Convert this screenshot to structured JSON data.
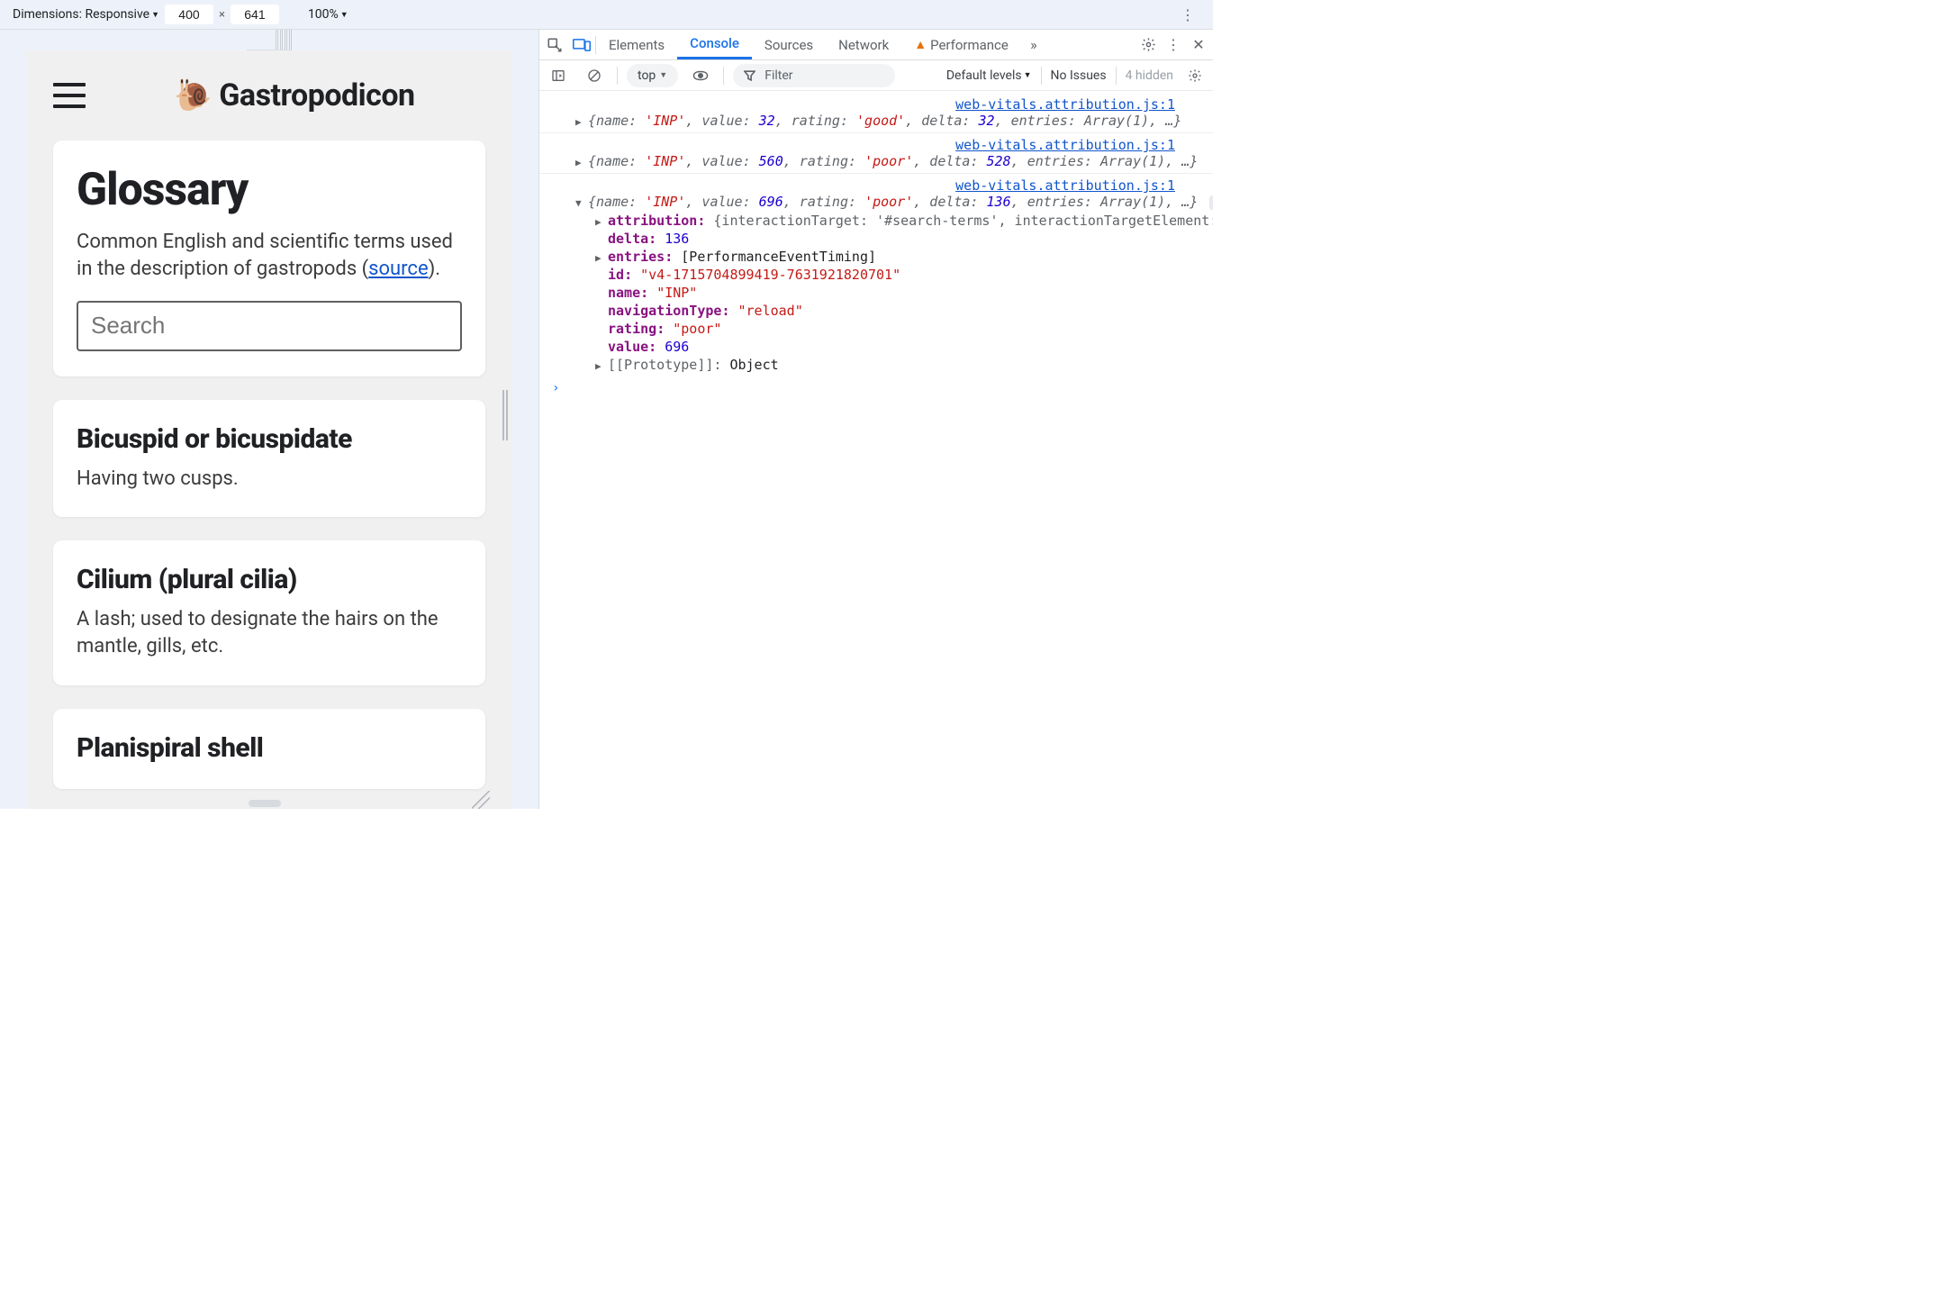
{
  "deviceToolbar": {
    "dimensionsLabel": "Dimensions: Responsive",
    "width": "400",
    "height": "641",
    "x": "×",
    "zoom": "100%"
  },
  "app": {
    "title": "Gastropodicon",
    "glossaryTitle": "Glossary",
    "glossaryDescPre": "Common English and scientific terms used in the description of gastropods (",
    "glossaryLink": "source",
    "glossaryDescPost": ").",
    "searchPlaceholder": "Search",
    "terms": [
      {
        "name": "Bicuspid or bicuspidate",
        "def": "Having two cusps."
      },
      {
        "name": "Cilium (plural cilia)",
        "def": "A lash; used to designate the hairs on the mantle, gills, etc."
      },
      {
        "name": "Planispiral shell",
        "def": ""
      }
    ]
  },
  "devtools": {
    "tabs": {
      "elements": "Elements",
      "console": "Console",
      "sources": "Sources",
      "network": "Network",
      "performance": "Performance"
    },
    "toolbar": {
      "context": "top",
      "filterPlaceholder": "Filter",
      "levels": "Default levels",
      "noIssues": "No Issues",
      "hidden": "4 hidden"
    },
    "sourceLink": "web-vitals.attribution.js:1",
    "logs": [
      {
        "name": "'INP'",
        "value": "32",
        "rating": "'good'",
        "delta": "32",
        "tail": "entries: Array(1), …}"
      },
      {
        "name": "'INP'",
        "value": "560",
        "rating": "'poor'",
        "delta": "528",
        "tail": "entries: Array(1), …}"
      },
      {
        "name": "'INP'",
        "value": "696",
        "rating": "'poor'",
        "delta": "136",
        "tail": "entries: Array(1), …}"
      }
    ],
    "expanded": {
      "attributionKey": "attribution",
      "attributionVal": "{interactionTarget: '#search-terms', interactionTargetElement: in",
      "deltaKey": "delta",
      "deltaVal": "136",
      "entriesKey": "entries",
      "entriesVal": "[PerformanceEventTiming]",
      "idKey": "id",
      "idVal": "\"v4-1715704899419-7631921820701\"",
      "nameKey": "name",
      "nameVal": "\"INP\"",
      "navTypeKey": "navigationType",
      "navTypeVal": "\"reload\"",
      "ratingKey": "rating",
      "ratingVal": "\"poor\"",
      "valueKey": "value",
      "valueVal": "696",
      "protoKey": "[[Prototype]]",
      "protoVal": "Object"
    }
  }
}
